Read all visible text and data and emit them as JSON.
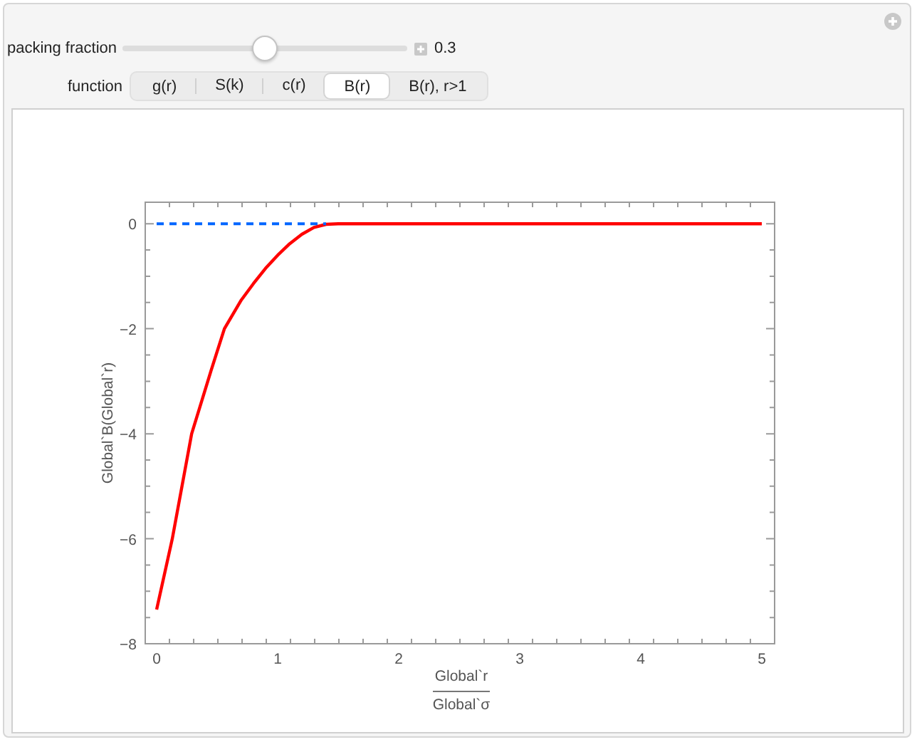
{
  "controls": {
    "slider": {
      "label": "packing fraction",
      "level": 0.5,
      "reading": "0.3"
    },
    "setter": {
      "label": "function",
      "options": [
        {
          "label": "g(r)",
          "selected": false
        },
        {
          "label": "S(k)",
          "selected": false
        },
        {
          "label": "c(r)",
          "selected": false
        },
        {
          "label": "B(r)",
          "selected": true
        },
        {
          "label": "B(r), r>1",
          "selected": false
        }
      ]
    }
  },
  "plot": {
    "chart_data": {
      "type": "line",
      "ylabel": "Global`B(Global`r)",
      "x": [
        0,
        0.13,
        0.29,
        0.45,
        0.56,
        0.7,
        0.8,
        0.9,
        1.0,
        1.1,
        1.2,
        1.3,
        1.4,
        1.5,
        2,
        3,
        4,
        5
      ],
      "series": [
        {
          "color": "#ff0000",
          "line_style": "solid",
          "values": [
            -7.35,
            -6,
            -4,
            -2.8,
            -2,
            -1.45,
            -1.14,
            -0.85,
            -0.6,
            -0.38,
            -0.2,
            -0.07,
            -0.01,
            0,
            0,
            0,
            0,
            0
          ]
        },
        {
          "color": "#0066ff",
          "line_style": "dashed",
          "values": [
            0,
            0,
            0,
            0,
            0,
            0,
            0,
            0,
            0,
            0,
            0,
            0,
            0,
            null,
            null,
            null,
            null,
            null
          ]
        }
      ],
      "xlim": [
        -0.094,
        5.106
      ],
      "ylim": [
        -8,
        0.41
      ],
      "xticks": [
        0,
        1,
        2,
        3,
        4,
        5
      ],
      "yticks": [
        {
          "value": -8,
          "label": "−8"
        },
        {
          "value": -6,
          "label": "−6"
        },
        {
          "value": -4,
          "label": "−4"
        },
        {
          "value": -2,
          "label": "−2"
        },
        {
          "value": 0,
          "label": "0"
        }
      ]
    },
    "x_label": {
      "numerator": "Global`r",
      "denominator": "Global`σ"
    }
  }
}
